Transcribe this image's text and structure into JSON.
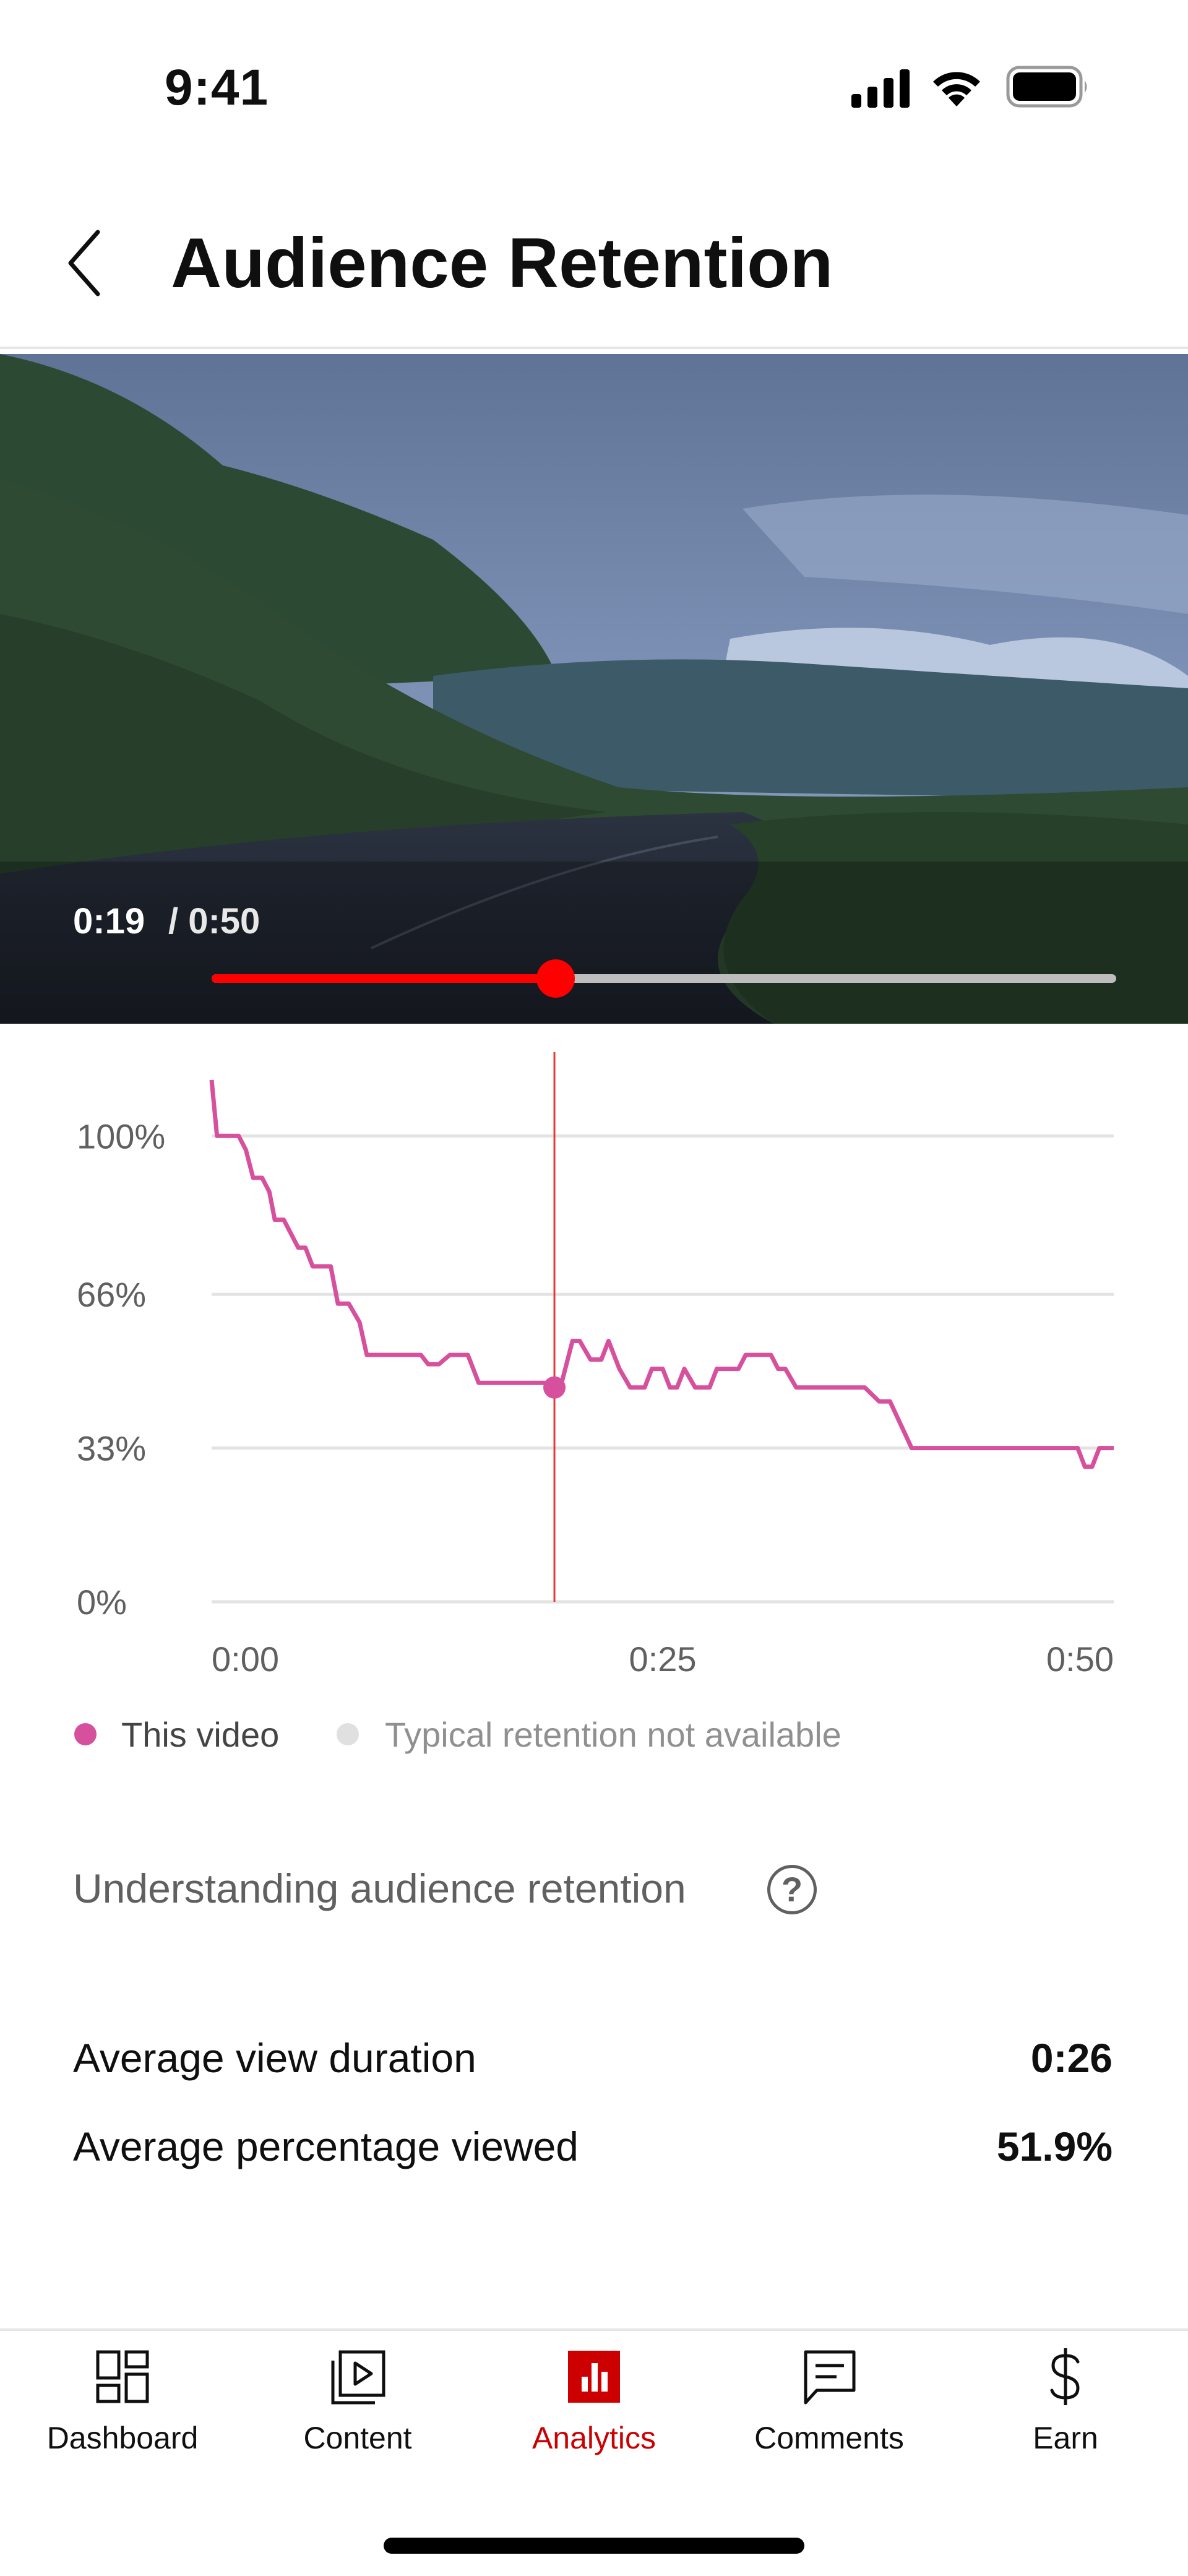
{
  "status_bar": {
    "time": "9:41"
  },
  "header": {
    "title": "Audience Retention"
  },
  "video": {
    "current_time": "0:19",
    "duration": "/ 0:50",
    "progress_fraction": 0.38,
    "colors": {
      "accent": "#ff0000"
    }
  },
  "chart_data": {
    "type": "line",
    "title": "",
    "xlabel": "",
    "ylabel": "",
    "x_ticks": [
      "0:00",
      "0:25",
      "0:50"
    ],
    "y_ticks": [
      "100%",
      "66%",
      "33%",
      "0%"
    ],
    "ylim": [
      0,
      110
    ],
    "xlim": [
      0,
      50
    ],
    "grid": true,
    "cursor_x": 19,
    "cursor_y": 46,
    "series": [
      {
        "name": "This video",
        "color": "#d6509e",
        "x": [
          0,
          0.3,
          0.6,
          1.5,
          1.9,
          2.3,
          2.8,
          3.2,
          3.5,
          4.0,
          4.4,
          4.8,
          5.2,
          5.6,
          6.0,
          6.6,
          7.0,
          7.6,
          8.2,
          8.6,
          9.0,
          9.4,
          10.0,
          10.6,
          11.0,
          11.6,
          12.0,
          12.6,
          13.2,
          13.8,
          14.2,
          14.8,
          15.2,
          15.6,
          16.0,
          16.6,
          17.2,
          17.6,
          18.0,
          18.4,
          19.0,
          19.4,
          20.0,
          20.4,
          21.0,
          21.6,
          22.0,
          22.6,
          23.2,
          23.6,
          24.0,
          24.4,
          25.0,
          25.4,
          25.8,
          26.2,
          26.8,
          27.2,
          27.6,
          28.0,
          28.6,
          29.2,
          29.6,
          30.2,
          31.0,
          31.4,
          31.8,
          32.4,
          33.0,
          33.6,
          34.2,
          35.0,
          35.6,
          36.2,
          37.0,
          37.6,
          38.2,
          38.8,
          39.6,
          40.4,
          41.0,
          41.6,
          42.2,
          42.8,
          43.4,
          44.0,
          44.6,
          45.2,
          45.8,
          46.4,
          47.0,
          47.6,
          48.0,
          48.4,
          48.8,
          49.2,
          49.6,
          50.0
        ],
        "y": [
          112,
          100,
          100,
          100,
          97,
          91,
          91,
          88,
          82,
          82,
          79,
          76,
          76,
          72,
          72,
          72,
          64,
          64,
          60,
          53,
          53,
          53,
          53,
          53,
          53,
          53,
          51,
          51,
          53,
          53,
          53,
          47,
          47,
          47,
          47,
          47,
          47,
          47,
          47,
          47,
          47,
          47,
          56,
          56,
          52,
          52,
          56,
          50,
          46,
          46,
          46,
          50,
          50,
          46,
          46,
          50,
          46,
          46,
          46,
          50,
          50,
          50,
          53,
          53,
          53,
          50,
          50,
          46,
          46,
          46,
          46,
          46,
          46,
          46,
          43,
          43,
          38,
          33,
          33,
          33,
          33,
          33,
          33,
          33,
          33,
          33,
          33,
          33,
          33,
          33,
          33,
          33,
          33,
          29,
          29,
          33,
          33,
          33
        ],
        "values_note": ""
      }
    ],
    "legend": [
      {
        "label": "This video",
        "color": "#d6509e"
      },
      {
        "label": "Typical retention not available",
        "color": "#e0e0e0"
      }
    ]
  },
  "info": {
    "understanding_label": "Understanding audience retention",
    "help_glyph": "?"
  },
  "metrics": [
    {
      "label": "Average view duration",
      "value": "0:26"
    },
    {
      "label": "Average percentage viewed",
      "value": "51.9%"
    }
  ],
  "bottom_nav": [
    {
      "label": "Dashboard",
      "icon": "dashboard-icon",
      "active": false
    },
    {
      "label": "Content",
      "icon": "content-icon",
      "active": false
    },
    {
      "label": "Analytics",
      "icon": "analytics-icon",
      "active": true
    },
    {
      "label": "Comments",
      "icon": "comments-icon",
      "active": false
    },
    {
      "label": "Earn",
      "icon": "earn-icon",
      "active": false
    }
  ]
}
